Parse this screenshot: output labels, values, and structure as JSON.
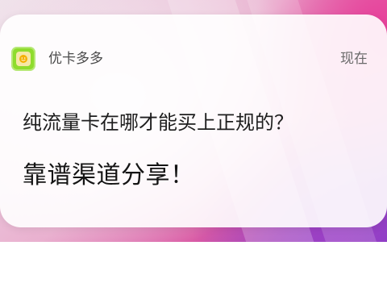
{
  "notification": {
    "app_name": "优卡多多",
    "timestamp": "现在",
    "title": "纯流量卡在哪才能买上正规的？",
    "body": "靠谱渠道分享！",
    "app_icon": {
      "name": "app-icon",
      "color": "#8fdc2d"
    }
  },
  "colors": {
    "card_background": "#ffffff",
    "wallpaper_pink": "#e8409a",
    "wallpaper_purple": "#7b3ec7"
  }
}
